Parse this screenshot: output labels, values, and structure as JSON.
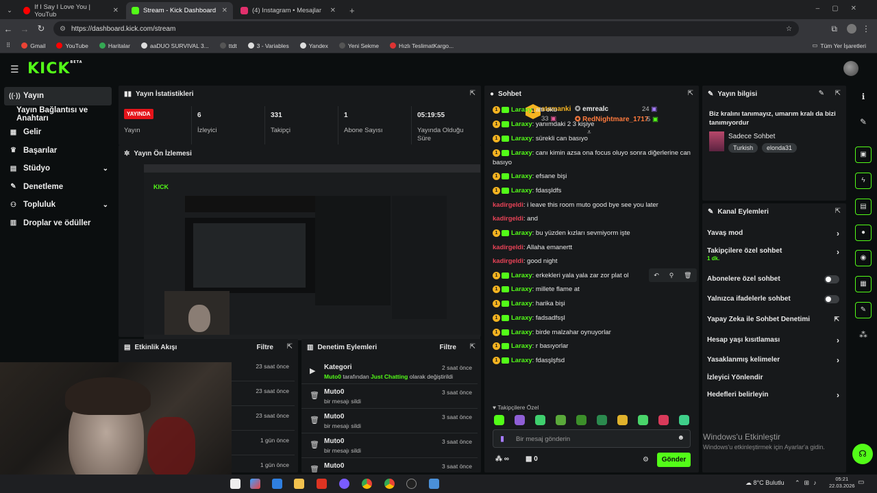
{
  "browser": {
    "tabs": [
      {
        "label": "If I Say I Love You | YouTub",
        "color": "#ff0000"
      },
      {
        "label": "Stream - Kick Dashboard",
        "color": "#53fc18"
      },
      {
        "label": "(4) Instagram • Mesajlar",
        "color": "#e1306c"
      }
    ],
    "url": "https://dashboard.kick.com/stream",
    "bookmarks": [
      "Gmail",
      "YouTube",
      "Haritalar",
      "aaDUO SURVIVAL 3...",
      "ttdt",
      "3 - Variables",
      "Yandex",
      "Yeni Sekme",
      "Hızlı TeslimatKargo..."
    ],
    "all_bookmarks": "Tüm Yer İşaretleri"
  },
  "kick": {
    "logo": "KICK",
    "logo_sup": "BETA",
    "sidebar": [
      {
        "label": "Yayın",
        "icon": "broadcast-icon"
      },
      {
        "label": "Yayın Bağlantısı ve Anahtarı",
        "icon": ""
      },
      {
        "label": "Gelir",
        "icon": "revenue-icon"
      },
      {
        "label": "Başarılar",
        "icon": "trophy-icon"
      },
      {
        "label": "Stüdyo",
        "icon": "studio-icon"
      },
      {
        "label": "Denetleme",
        "icon": "wrench-icon"
      },
      {
        "label": "Topluluk",
        "icon": "community-icon"
      },
      {
        "label": "Droplar ve ödüller",
        "icon": "drops-icon"
      }
    ]
  },
  "stats": {
    "title": "Yayın İstatistikleri",
    "live_badge": "YAYINDA",
    "items": [
      {
        "value": "",
        "label": "Yayın"
      },
      {
        "value": "6",
        "label": "İzleyici"
      },
      {
        "value": "331",
        "label": "Takipçi"
      },
      {
        "value": "1",
        "label": "Abone Sayısı"
      },
      {
        "value": "05:19:55",
        "label": "Yayında Olduğu Süre"
      }
    ]
  },
  "preview": {
    "title": "Yayın Ön İzlemesi"
  },
  "activity": {
    "title": "Etkinlik Akışı",
    "filter": "Filtre",
    "times": [
      "23 saat önce",
      "23 saat önce",
      "23 saat önce",
      "1 gün önce",
      "1 gün önce"
    ]
  },
  "moderation": {
    "title": "Denetim Eylemleri",
    "filter": "Filtre",
    "items": [
      {
        "name": "Kategori",
        "user": "Muto0",
        "mid": " tarafından ",
        "cat": "Just Chatting",
        "tail": " olarak değiştirildi",
        "time": "2 saat önce"
      },
      {
        "name": "Muto0",
        "desc": "bir mesajı sildi",
        "time": "3 saat önce"
      },
      {
        "name": "Muto0",
        "desc": "bir mesajı sildi",
        "time": "3 saat önce"
      },
      {
        "name": "Muto0",
        "desc": "bir mesajı sildi",
        "time": "3 saat önce"
      },
      {
        "name": "Muto0",
        "desc": "",
        "time": "3 saat önce"
      }
    ]
  },
  "chat": {
    "title": "Sohbet",
    "top": [
      {
        "name": "atamanki",
        "count": "33"
      },
      {
        "name": "emrealc",
        "count": "24"
      },
      {
        "name": "RedNightmare_1717",
        "count": "5"
      }
    ],
    "rank": "1",
    "messages": [
      {
        "user": "Laraxy",
        "text": "altı oku",
        "type": "sub"
      },
      {
        "user": "Laraxy",
        "text": "yanımdaki 2 3 kişiye",
        "type": "sub"
      },
      {
        "user": "Laraxy",
        "text": "sürekli can basıyo",
        "type": "sub"
      },
      {
        "user": "Laraxy",
        "text": "canı kimin azsa ona focus oluyo sonra diğerlerine can basıyo",
        "type": "sub"
      },
      {
        "user": "Laraxy",
        "text": "efsane bişi",
        "type": "sub"
      },
      {
        "user": "Laraxy",
        "text": "fdasşldfs",
        "type": "sub"
      },
      {
        "user": "kadirgeldi",
        "text": "i leave this room muto good bye see you later",
        "type": "red"
      },
      {
        "user": "kadirgeldi",
        "text": "and",
        "type": "red"
      },
      {
        "user": "Laraxy",
        "text": "bu yüzden kızları sevmiyorm işte",
        "type": "sub"
      },
      {
        "user": "kadirgeldi",
        "text": "Allaha emanertt",
        "type": "red"
      },
      {
        "user": "kadirgeldi",
        "text": "good night",
        "type": "red"
      },
      {
        "user": "Laraxy",
        "text": "erkekleri yala yala zar zor plat ol",
        "type": "sub"
      },
      {
        "user": "Laraxy",
        "text": "millete flame at",
        "type": "sub"
      },
      {
        "user": "Laraxy",
        "text": "harika bişi",
        "type": "sub"
      },
      {
        "user": "Laraxy",
        "text": "fadsadfsşl",
        "type": "sub"
      },
      {
        "user": "Laraxy",
        "text": "birde malzahar oynuyorlar",
        "type": "sub"
      },
      {
        "user": "Laraxy",
        "text": "r basıyorlar",
        "type": "sub"
      },
      {
        "user": "Laraxy",
        "text": "fdasşlşfsd",
        "type": "sub"
      }
    ],
    "followers_only": "Takipçilere Özel",
    "placeholder": "Bir mesaj gönderin",
    "points": "∞",
    "gift_count": "0",
    "send": "Gönder"
  },
  "info": {
    "title": "Yayın bilgisi",
    "stream_title": "Biz kralını tanımayız, umarım kralı da bizi tanımıyordur",
    "category": "Sadece Sohbet",
    "tags": [
      "Turkish",
      "elonda31"
    ]
  },
  "channel_actions": {
    "title": "Kanal Eylemleri",
    "items": [
      {
        "label": "Yavaş mod",
        "kind": "arrow",
        "sub": ""
      },
      {
        "label": "Takipçilere özel sohbet",
        "kind": "arrow",
        "sub": "1 dk."
      },
      {
        "label": "Abonelere özel sohbet",
        "kind": "toggle",
        "sub": ""
      },
      {
        "label": "Yalnızca ifadelerle sohbet",
        "kind": "toggle",
        "sub": ""
      },
      {
        "label": "Yapay Zeka ile Sohbet Denetimi",
        "kind": "ext",
        "sub": ""
      },
      {
        "label": "Hesap yaşı kısıtlaması",
        "kind": "arrow",
        "sub": ""
      },
      {
        "label": "Yasaklanmış kelimeler",
        "kind": "arrow",
        "sub": ""
      },
      {
        "label": "İzleyici Yönlendir",
        "kind": "none",
        "sub": ""
      },
      {
        "label": "Hedefleri belirleyin",
        "kind": "arrow",
        "sub": ""
      }
    ]
  },
  "windows": {
    "activate_title": "Windows'u Etkinleştir",
    "activate_sub": "Windows'u etkinleştirmek için Ayarlar'a gidin.",
    "weather": "8°C  Bulutlu",
    "time": "05:21",
    "date": "22.03.2026"
  }
}
